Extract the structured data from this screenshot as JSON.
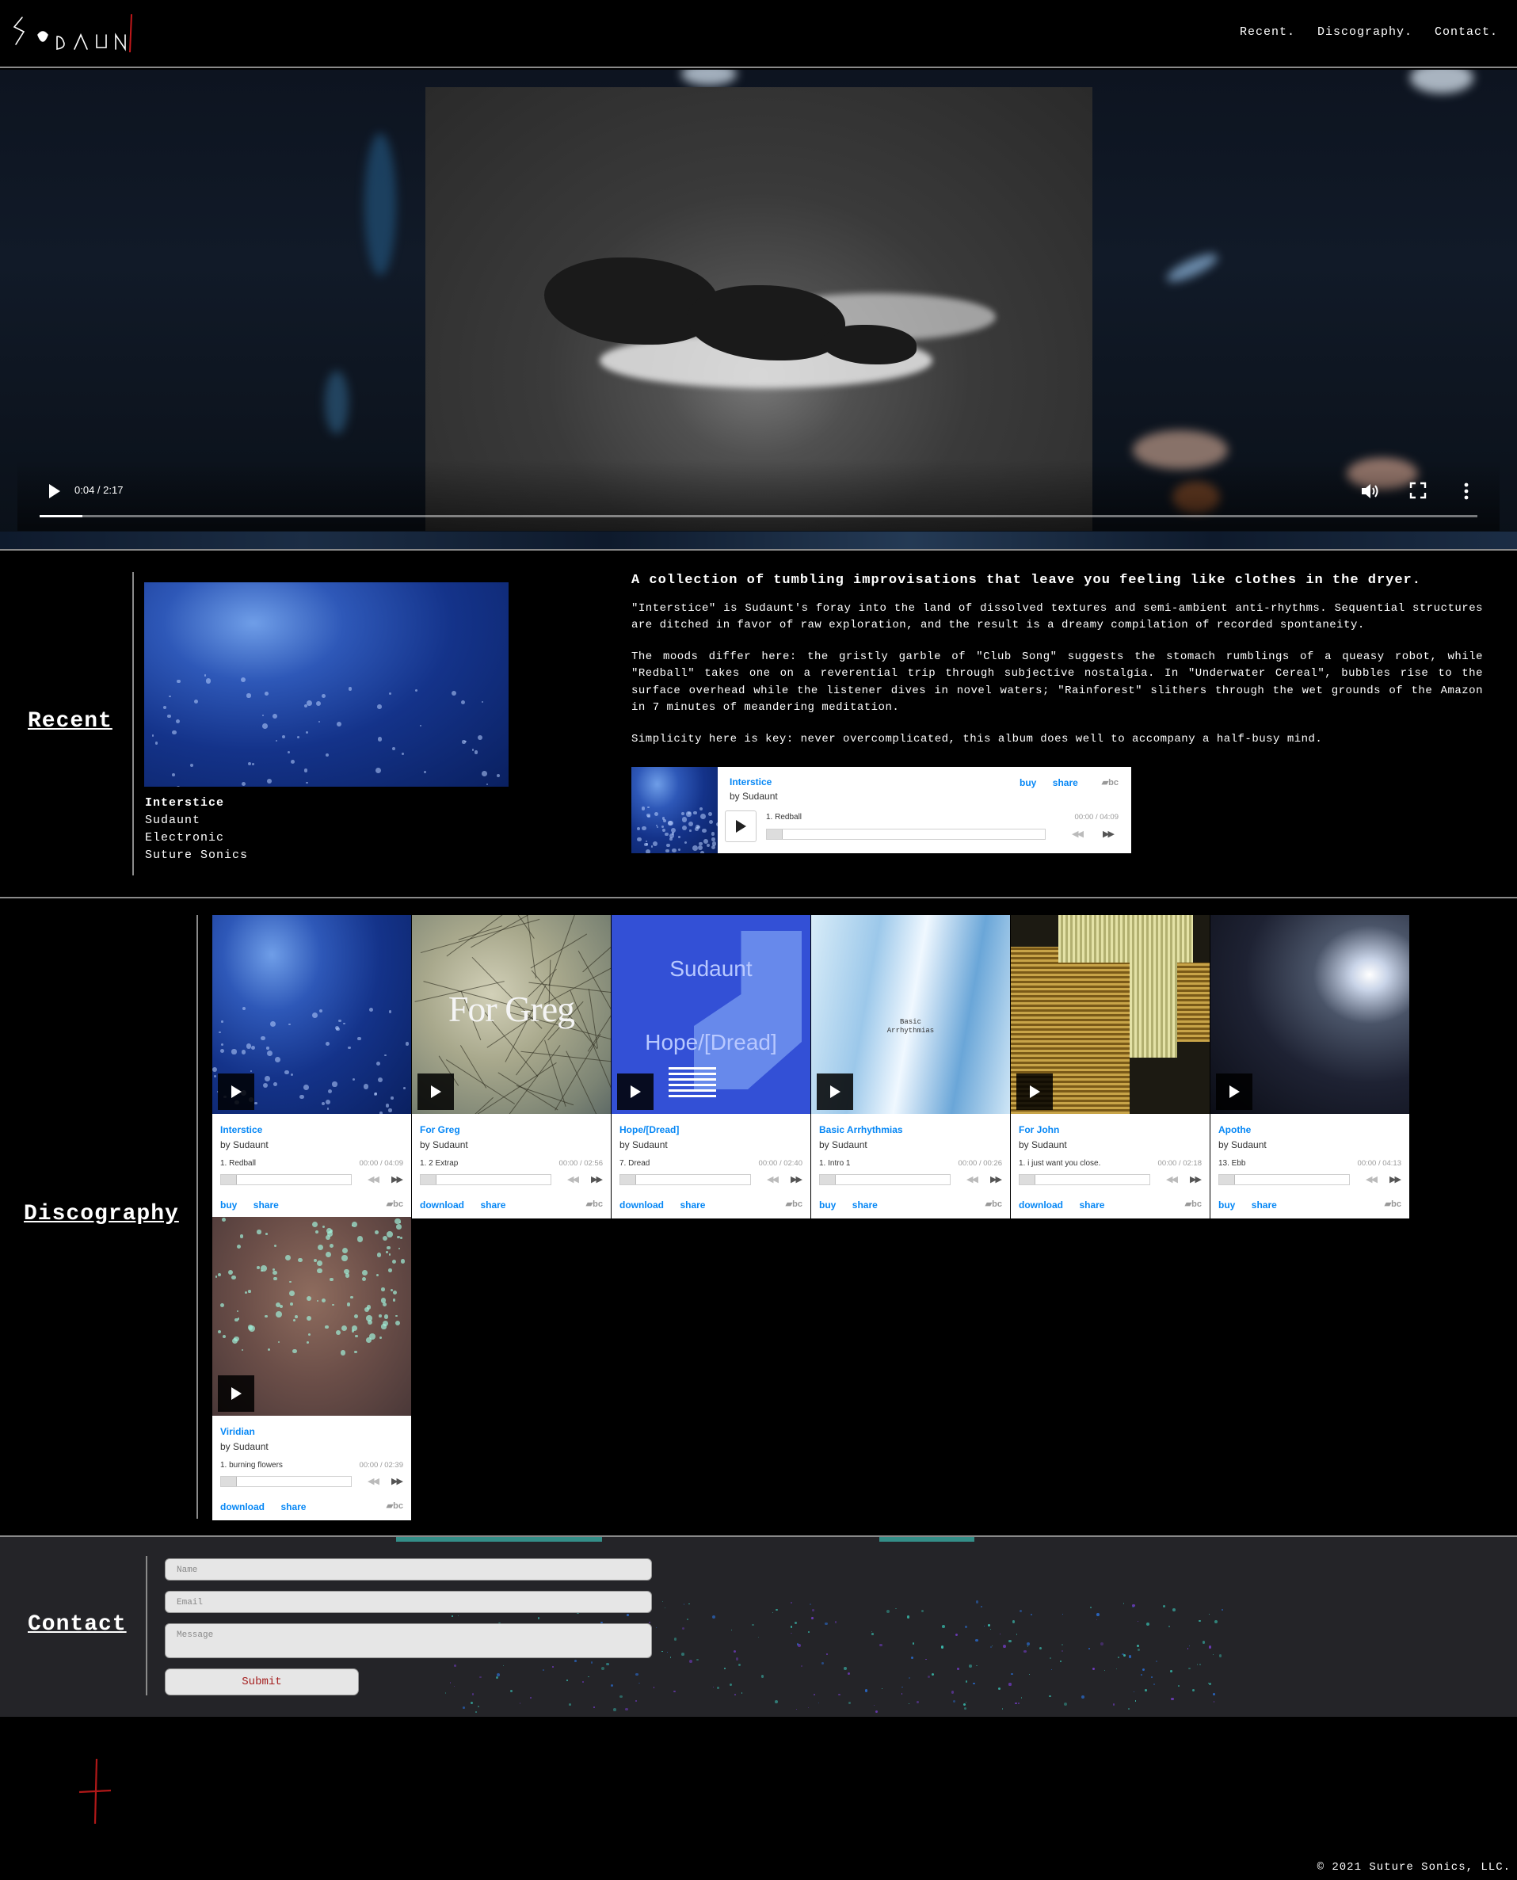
{
  "brand": {
    "logo_text": "SUDAUNT"
  },
  "nav": [
    {
      "label": "Recent."
    },
    {
      "label": "Discography."
    },
    {
      "label": "Contact."
    }
  ],
  "video": {
    "time": "0:04 / 2:17",
    "progress": 0.03
  },
  "sections": {
    "recent": "Recent",
    "discography": "Discography",
    "contact": "Contact"
  },
  "recent": {
    "meta": [
      "Interstice",
      "Sudaunt",
      "Electronic",
      "Suture Sonics"
    ],
    "headline": "A collection of tumbling improvisations that leave you feeling like clothes in the dryer.",
    "paragraphs": [
      "\"Interstice\" is Sudaunt's foray into the land of dissolved textures and semi-ambient anti-rhythms. Sequential structures are ditched in favor of raw exploration, and the result is a dreamy compilation of recorded spontaneity.",
      "The moods differ here: the gristly garble of \"Club Song\" suggests the stomach rumblings of a queasy robot, while \"Redball\" takes one on a reverential trip through subjective nostalgia. In \"Underwater Cereal\", bubbles rise to the surface overhead while the listener dives in novel waters; \"Rainforest\" slithers through the wet grounds of the Amazon in 7 minutes of meandering meditation.",
      "Simplicity here is key: never overcomplicated, this album does well to accompany a half-busy mind."
    ],
    "widget": {
      "title": "Interstice",
      "by": "by Sudaunt",
      "track": "1.   Redball",
      "time": "00:00 / 04:09",
      "buy": "buy",
      "share": "share",
      "bc": "bc"
    }
  },
  "albums": [
    {
      "title": "Interstice",
      "by": "by Sudaunt",
      "track": "1.   Redball",
      "time": "00:00 / 04:09",
      "action1": "buy",
      "action2": "share",
      "bc": "bc"
    },
    {
      "title": "For Greg",
      "by": "by Sudaunt",
      "track": "1.   2 Extrap",
      "time": "00:00 / 02:56",
      "action1": "download",
      "action2": "share",
      "bc": "bc",
      "cover_text": "For Greg"
    },
    {
      "title": "Hope/[Dread]",
      "by": "by Sudaunt",
      "track": "7.   Dread",
      "time": "00:00 / 02:40",
      "action1": "download",
      "action2": "share",
      "bc": "bc",
      "cover_text": "Sudaunt",
      "cover_text2": "Hope/[Dread]"
    },
    {
      "title": "Basic Arrhythmias",
      "by": "by Sudaunt",
      "track": "1.   Intro 1",
      "time": "00:00 / 00:26",
      "action1": "buy",
      "action2": "share",
      "bc": "bc",
      "cover_text": "Basic",
      "cover_text2": "Arrhythmias"
    },
    {
      "title": "For John",
      "by": "by Sudaunt",
      "track": "1.   i just want you close.",
      "time": "00:00 / 02:18",
      "action1": "download",
      "action2": "share",
      "bc": "bc"
    },
    {
      "title": "Apothe",
      "by": "by Sudaunt",
      "track": "13.  Ebb",
      "time": "00:00 / 04:13",
      "action1": "buy",
      "action2": "share",
      "bc": "bc"
    },
    {
      "title": "Viridian",
      "by": "by Sudaunt",
      "track": "1.   burning flowers",
      "time": "00:00 / 02:39",
      "action1": "download",
      "action2": "share",
      "bc": "bc"
    }
  ],
  "contact": {
    "name_placeholder": "Name",
    "email_placeholder": "Email",
    "message_placeholder": "Message",
    "submit": "Submit"
  },
  "footer": {
    "copyright": "© 2021 Suture Sonics, LLC."
  },
  "colors": {
    "link_blue": "#0687f5",
    "rule": "#8a8a8a",
    "submit_red": "#a52020",
    "mark_red": "#b01818"
  }
}
